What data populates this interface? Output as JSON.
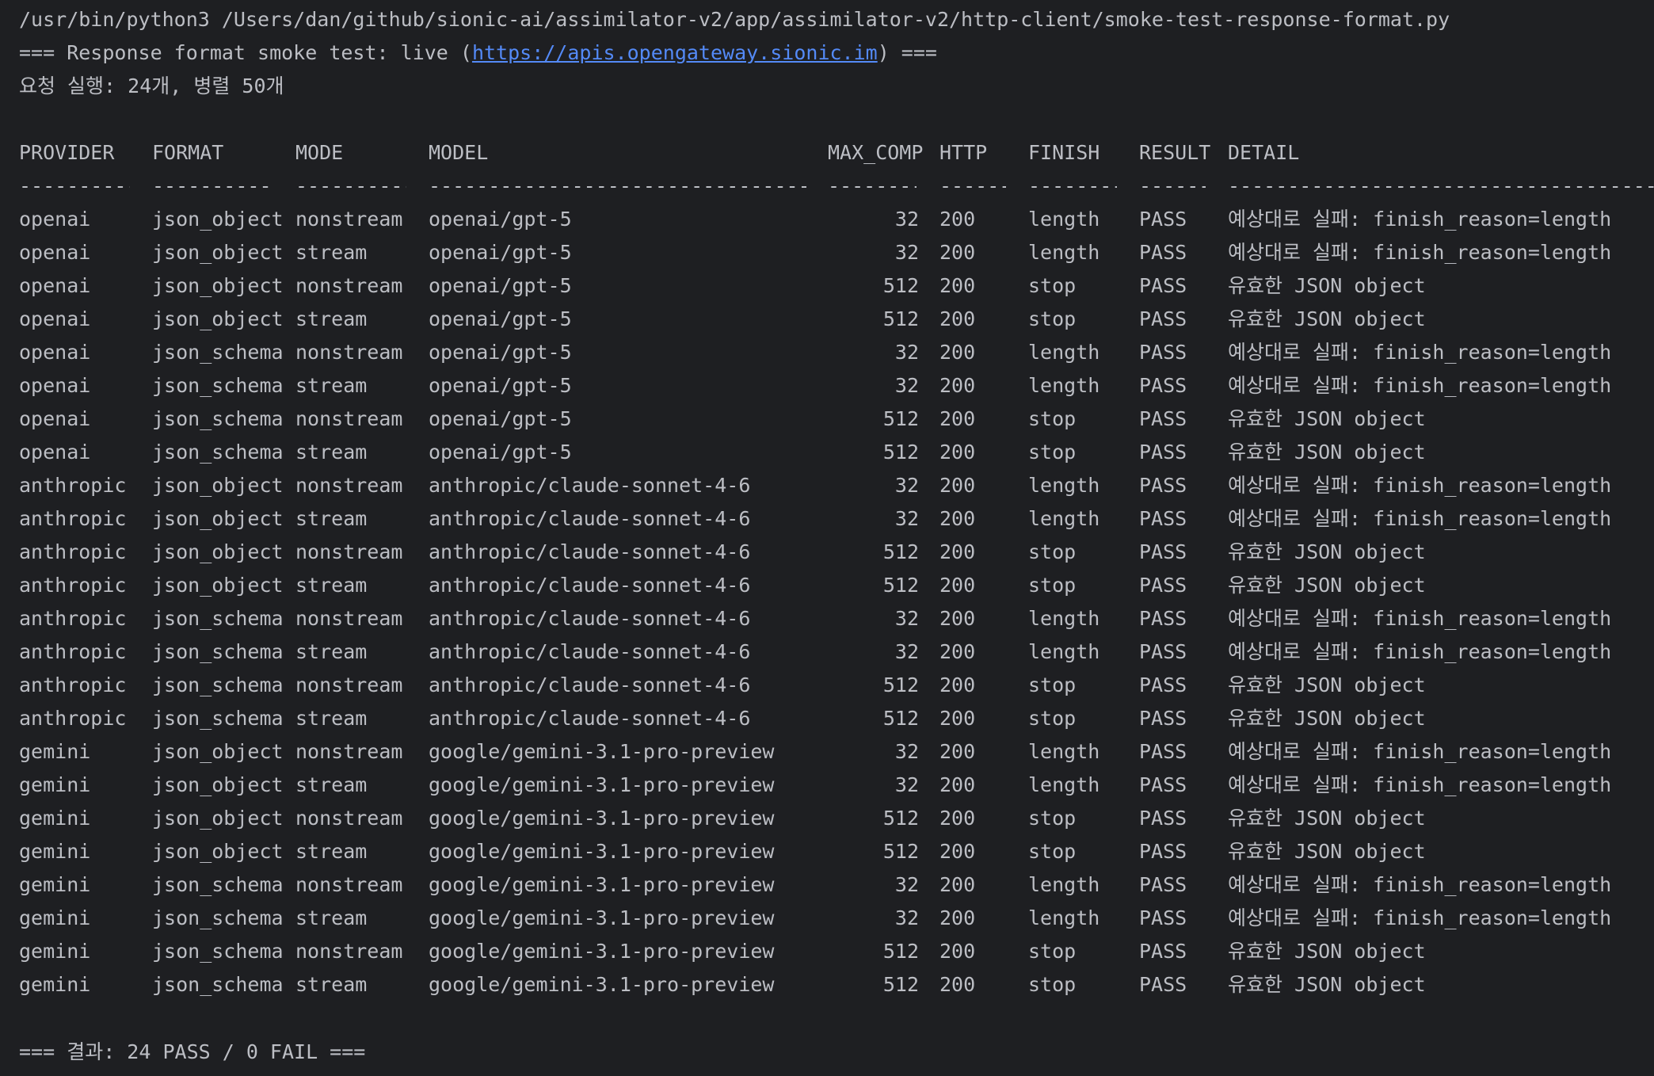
{
  "terminal": {
    "command": "/usr/bin/python3 /Users/dan/github/sionic-ai/assimilator-v2/app/assimilator-v2/http-client/smoke-test-response-format.py",
    "banner_prefix": "=== Response format smoke test: live (",
    "banner_link": "https://apis.opengateway.sionic.im",
    "banner_suffix": ") ===",
    "run_info": "요청 실행: 24개, 병렬 50개",
    "summary": "=== 결과: 24 PASS / 0 FAIL ==="
  },
  "table": {
    "headers": {
      "provider": "PROVIDER",
      "format": "FORMAT",
      "mode": "MODE",
      "model": "MODEL",
      "max_comp": "MAX_COMP",
      "http": "HTTP",
      "finish": "FINISH",
      "result": "RESULT",
      "detail": "DETAIL"
    },
    "rules": {
      "provider": "----------",
      "format": "-----------",
      "mode": "----------",
      "model": "----------------------------------",
      "max_comp": "--------",
      "http": "------",
      "finish": "--------",
      "result": "------",
      "detail": "----------------------------------------------------"
    },
    "rows": [
      {
        "provider": "openai",
        "format": "json_object",
        "mode": "nonstream",
        "model": "openai/gpt-5",
        "max_comp": "32",
        "http": "200",
        "finish": "length",
        "result": "PASS",
        "detail": "예상대로 실패: finish_reason=length"
      },
      {
        "provider": "openai",
        "format": "json_object",
        "mode": "stream",
        "model": "openai/gpt-5",
        "max_comp": "32",
        "http": "200",
        "finish": "length",
        "result": "PASS",
        "detail": "예상대로 실패: finish_reason=length"
      },
      {
        "provider": "openai",
        "format": "json_object",
        "mode": "nonstream",
        "model": "openai/gpt-5",
        "max_comp": "512",
        "http": "200",
        "finish": "stop",
        "result": "PASS",
        "detail": "유효한 JSON object"
      },
      {
        "provider": "openai",
        "format": "json_object",
        "mode": "stream",
        "model": "openai/gpt-5",
        "max_comp": "512",
        "http": "200",
        "finish": "stop",
        "result": "PASS",
        "detail": "유효한 JSON object"
      },
      {
        "provider": "openai",
        "format": "json_schema",
        "mode": "nonstream",
        "model": "openai/gpt-5",
        "max_comp": "32",
        "http": "200",
        "finish": "length",
        "result": "PASS",
        "detail": "예상대로 실패: finish_reason=length"
      },
      {
        "provider": "openai",
        "format": "json_schema",
        "mode": "stream",
        "model": "openai/gpt-5",
        "max_comp": "32",
        "http": "200",
        "finish": "length",
        "result": "PASS",
        "detail": "예상대로 실패: finish_reason=length"
      },
      {
        "provider": "openai",
        "format": "json_schema",
        "mode": "nonstream",
        "model": "openai/gpt-5",
        "max_comp": "512",
        "http": "200",
        "finish": "stop",
        "result": "PASS",
        "detail": "유효한 JSON object"
      },
      {
        "provider": "openai",
        "format": "json_schema",
        "mode": "stream",
        "model": "openai/gpt-5",
        "max_comp": "512",
        "http": "200",
        "finish": "stop",
        "result": "PASS",
        "detail": "유효한 JSON object"
      },
      {
        "provider": "anthropic",
        "format": "json_object",
        "mode": "nonstream",
        "model": "anthropic/claude-sonnet-4-6",
        "max_comp": "32",
        "http": "200",
        "finish": "length",
        "result": "PASS",
        "detail": "예상대로 실패: finish_reason=length"
      },
      {
        "provider": "anthropic",
        "format": "json_object",
        "mode": "stream",
        "model": "anthropic/claude-sonnet-4-6",
        "max_comp": "32",
        "http": "200",
        "finish": "length",
        "result": "PASS",
        "detail": "예상대로 실패: finish_reason=length"
      },
      {
        "provider": "anthropic",
        "format": "json_object",
        "mode": "nonstream",
        "model": "anthropic/claude-sonnet-4-6",
        "max_comp": "512",
        "http": "200",
        "finish": "stop",
        "result": "PASS",
        "detail": "유효한 JSON object"
      },
      {
        "provider": "anthropic",
        "format": "json_object",
        "mode": "stream",
        "model": "anthropic/claude-sonnet-4-6",
        "max_comp": "512",
        "http": "200",
        "finish": "stop",
        "result": "PASS",
        "detail": "유효한 JSON object"
      },
      {
        "provider": "anthropic",
        "format": "json_schema",
        "mode": "nonstream",
        "model": "anthropic/claude-sonnet-4-6",
        "max_comp": "32",
        "http": "200",
        "finish": "length",
        "result": "PASS",
        "detail": "예상대로 실패: finish_reason=length"
      },
      {
        "provider": "anthropic",
        "format": "json_schema",
        "mode": "stream",
        "model": "anthropic/claude-sonnet-4-6",
        "max_comp": "32",
        "http": "200",
        "finish": "length",
        "result": "PASS",
        "detail": "예상대로 실패: finish_reason=length"
      },
      {
        "provider": "anthropic",
        "format": "json_schema",
        "mode": "nonstream",
        "model": "anthropic/claude-sonnet-4-6",
        "max_comp": "512",
        "http": "200",
        "finish": "stop",
        "result": "PASS",
        "detail": "유효한 JSON object"
      },
      {
        "provider": "anthropic",
        "format": "json_schema",
        "mode": "stream",
        "model": "anthropic/claude-sonnet-4-6",
        "max_comp": "512",
        "http": "200",
        "finish": "stop",
        "result": "PASS",
        "detail": "유효한 JSON object"
      },
      {
        "provider": "gemini",
        "format": "json_object",
        "mode": "nonstream",
        "model": "google/gemini-3.1-pro-preview",
        "max_comp": "32",
        "http": "200",
        "finish": "length",
        "result": "PASS",
        "detail": "예상대로 실패: finish_reason=length"
      },
      {
        "provider": "gemini",
        "format": "json_object",
        "mode": "stream",
        "model": "google/gemini-3.1-pro-preview",
        "max_comp": "32",
        "http": "200",
        "finish": "length",
        "result": "PASS",
        "detail": "예상대로 실패: finish_reason=length"
      },
      {
        "provider": "gemini",
        "format": "json_object",
        "mode": "nonstream",
        "model": "google/gemini-3.1-pro-preview",
        "max_comp": "512",
        "http": "200",
        "finish": "stop",
        "result": "PASS",
        "detail": "유효한 JSON object"
      },
      {
        "provider": "gemini",
        "format": "json_object",
        "mode": "stream",
        "model": "google/gemini-3.1-pro-preview",
        "max_comp": "512",
        "http": "200",
        "finish": "stop",
        "result": "PASS",
        "detail": "유효한 JSON object"
      },
      {
        "provider": "gemini",
        "format": "json_schema",
        "mode": "nonstream",
        "model": "google/gemini-3.1-pro-preview",
        "max_comp": "32",
        "http": "200",
        "finish": "length",
        "result": "PASS",
        "detail": "예상대로 실패: finish_reason=length"
      },
      {
        "provider": "gemini",
        "format": "json_schema",
        "mode": "stream",
        "model": "google/gemini-3.1-pro-preview",
        "max_comp": "32",
        "http": "200",
        "finish": "length",
        "result": "PASS",
        "detail": "예상대로 실패: finish_reason=length"
      },
      {
        "provider": "gemini",
        "format": "json_schema",
        "mode": "nonstream",
        "model": "google/gemini-3.1-pro-preview",
        "max_comp": "512",
        "http": "200",
        "finish": "stop",
        "result": "PASS",
        "detail": "유효한 JSON object"
      },
      {
        "provider": "gemini",
        "format": "json_schema",
        "mode": "stream",
        "model": "google/gemini-3.1-pro-preview",
        "max_comp": "512",
        "http": "200",
        "finish": "stop",
        "result": "PASS",
        "detail": "유효한 JSON object"
      }
    ]
  }
}
